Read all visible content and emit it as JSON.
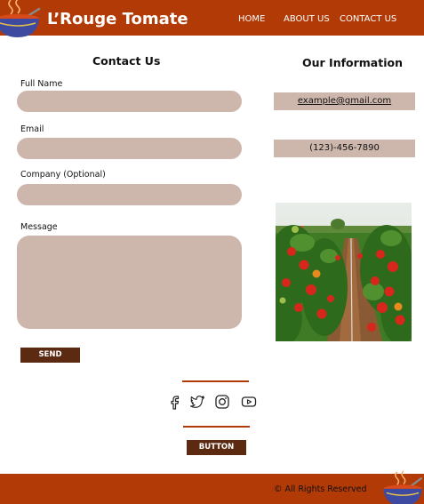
{
  "header": {
    "brand": "L’Rouge Tomate",
    "nav": [
      "HOME",
      "ABOUT US",
      "CONTACT US"
    ]
  },
  "contact": {
    "title": "Contact Us",
    "fields": {
      "full_name": {
        "label": "Full Name",
        "value": ""
      },
      "email": {
        "label": "Email",
        "value": ""
      },
      "company": {
        "label": "Company (Optional)",
        "value": ""
      },
      "message": {
        "label": "Message",
        "value": ""
      }
    },
    "send_label": "SEND"
  },
  "info": {
    "title": "Our Information",
    "email": "example@gmail.com",
    "phone": "(123)-456-7890"
  },
  "social": [
    "facebook-icon",
    "twitter-icon",
    "instagram-icon",
    "youtube-icon"
  ],
  "button_label": "BUTTON",
  "footer": {
    "copyright": "© All Rights Reserved"
  },
  "colors": {
    "header_bg": "#b23a06",
    "field_bg": "#cdb7ad",
    "button_bg": "#5c2a10",
    "white": "#ffffff"
  }
}
